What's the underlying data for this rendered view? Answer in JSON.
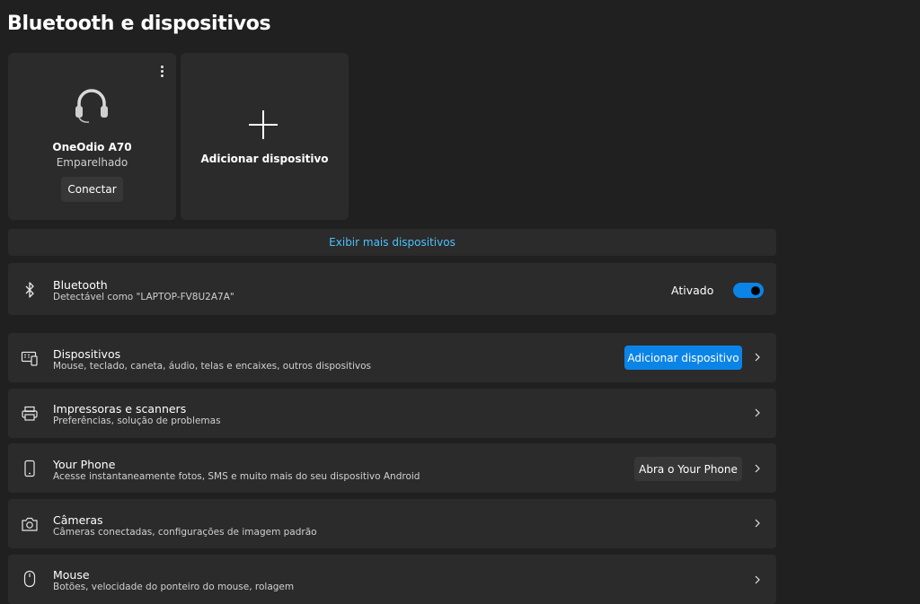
{
  "header": {
    "title": "Bluetooth e dispositivos"
  },
  "cards": {
    "headset": {
      "name": "OneOdio A70",
      "status": "Emparelhado",
      "connect_label": "Conectar",
      "icon": "headset-icon"
    },
    "add": {
      "label": "Adicionar dispositivo",
      "icon": "plus-icon"
    }
  },
  "show_more_label": "Exibir mais dispositivos",
  "bluetooth": {
    "title": "Bluetooth",
    "subtitle": "Detectável como \"LAPTOP-FV8U2A7A\"",
    "state_label": "Ativado",
    "enabled": true
  },
  "rows": [
    {
      "id": "devices",
      "title": "Dispositivos",
      "subtitle": "Mouse, teclado, caneta, áudio, telas e encaixes, outros dispositivos",
      "button_label": "Adicionar dispositivo",
      "icon": "devices-icon"
    },
    {
      "id": "printers",
      "title": "Impressoras e scanners",
      "subtitle": "Preferências, solução de problemas",
      "icon": "printer-icon"
    },
    {
      "id": "phone",
      "title": "Your Phone",
      "subtitle": "Acesse instantaneamente fotos, SMS e muito mais do seu dispositivo Android",
      "button_label": "Abra o Your Phone",
      "icon": "phone-icon"
    },
    {
      "id": "cameras",
      "title": "Câmeras",
      "subtitle": "Câmeras conectadas, configurações de imagem padrão",
      "icon": "camera-icon"
    },
    {
      "id": "mouse",
      "title": "Mouse",
      "subtitle": "Botões, velocidade do ponteiro do mouse, rolagem",
      "icon": "mouse-icon"
    }
  ],
  "colors": {
    "accent": "#0b84e8",
    "link": "#4cc2ff",
    "card": "#2b2b2b",
    "background": "#202020"
  }
}
